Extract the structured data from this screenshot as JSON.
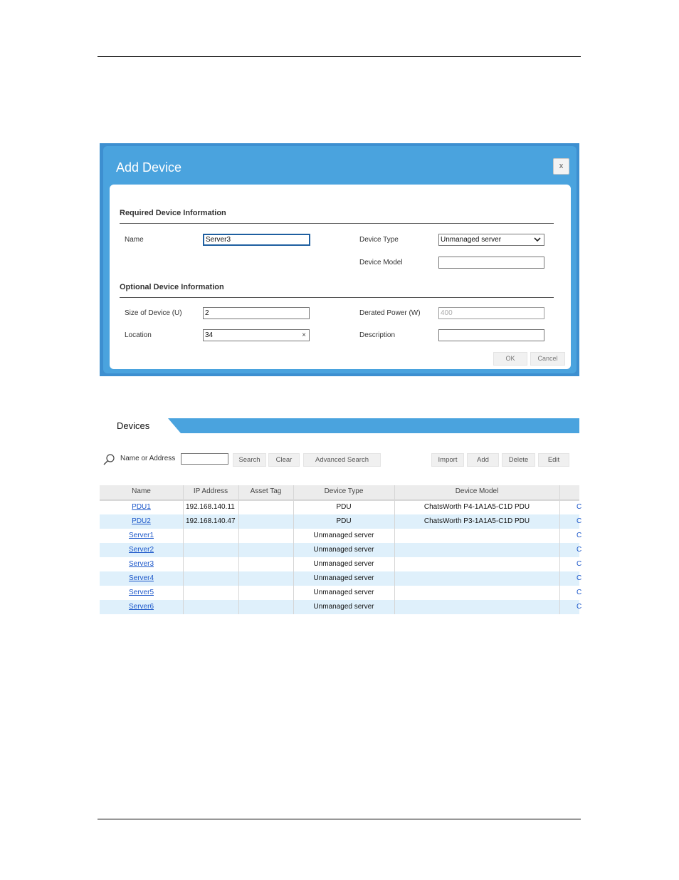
{
  "dialog": {
    "title": "Add Device",
    "close_label": "x",
    "required_section": "Required Device Information",
    "optional_section": "Optional Device Information",
    "name_label": "Name",
    "name_value": "Server3",
    "device_type_label": "Device Type",
    "device_type_value": "Unmanaged server",
    "device_model_label": "Device Model",
    "device_model_value": "",
    "size_label": "Size of Device (U)",
    "size_value": "2",
    "derated_power_label": "Derated Power (W)",
    "derated_power_value": "400",
    "location_label": "Location",
    "location_value": "34",
    "clear_label": "×",
    "description_label": "Description",
    "description_value": "",
    "ok_label": "OK",
    "cancel_label": "Cancel"
  },
  "devices": {
    "tab_label": "Devices",
    "search_label": "Name or Address",
    "search_value": "",
    "buttons": {
      "search": "Search",
      "clear": "Clear",
      "advanced_search": "Advanced Search",
      "import": "Import",
      "add": "Add",
      "delete": "Delete",
      "edit": "Edit"
    },
    "columns": [
      "Name",
      "IP Address",
      "Asset Tag",
      "Device Type",
      "Device Model"
    ],
    "rows": [
      {
        "name": "PDU1",
        "ip": "192.168.140.11",
        "asset_tag": "",
        "type": "PDU",
        "model": "ChatsWorth P4-1A1A5-C1D PDU",
        "edge": "C"
      },
      {
        "name": "PDU2",
        "ip": "192.168.140.47",
        "asset_tag": "",
        "type": "PDU",
        "model": "ChatsWorth P3-1A1A5-C1D PDU",
        "edge": "C"
      },
      {
        "name": "Server1",
        "ip": "",
        "asset_tag": "",
        "type": "Unmanaged server",
        "model": "",
        "edge": "C"
      },
      {
        "name": "Server2",
        "ip": "",
        "asset_tag": "",
        "type": "Unmanaged server",
        "model": "",
        "edge": "C"
      },
      {
        "name": "Server3",
        "ip": "",
        "asset_tag": "",
        "type": "Unmanaged server",
        "model": "",
        "edge": "C"
      },
      {
        "name": "Server4",
        "ip": "",
        "asset_tag": "",
        "type": "Unmanaged server",
        "model": "",
        "edge": "C"
      },
      {
        "name": "Server5",
        "ip": "",
        "asset_tag": "",
        "type": "Unmanaged server",
        "model": "",
        "edge": "C"
      },
      {
        "name": "Server6",
        "ip": "",
        "asset_tag": "",
        "type": "Unmanaged server",
        "model": "",
        "edge": "C"
      }
    ]
  },
  "colors": {
    "dialog_blue": "#4aa3de",
    "tab_blue": "#4aa3de",
    "row_alt": "#dff0fb",
    "link": "#1a56c9"
  }
}
